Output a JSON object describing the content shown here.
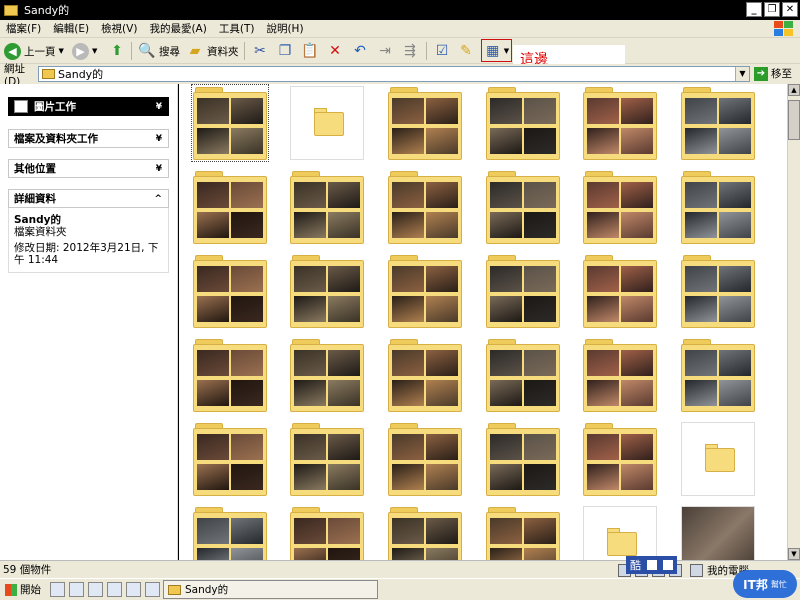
{
  "window": {
    "title": "Sandy的",
    "buttons": {
      "minimize": "_",
      "restore": "❐",
      "close": "✕"
    }
  },
  "menu": [
    "檔案(F)",
    "編輯(E)",
    "檢視(V)",
    "我的最愛(A)",
    "工具(T)",
    "說明(H)"
  ],
  "toolbar": {
    "back_label": "上一頁",
    "search_label": "搜尋",
    "folders_label": "資料夾"
  },
  "annotation": {
    "text": "這邊",
    "color": "#e00000"
  },
  "address": {
    "label": "網址(D)",
    "value": "Sandy的",
    "go_label": "移至"
  },
  "left_pane": {
    "picture_tasks": "圖片工作",
    "file_folder_tasks": "檔案及資料夾工作",
    "other_places": "其他位置",
    "details": {
      "header": "詳細資料",
      "name": "Sandy的",
      "type": "檔案資料夾",
      "modified": "修改日期: 2012年3月21日, 下午 11:44"
    }
  },
  "status": {
    "count": "59 個物件",
    "my_computer": "我的電腦"
  },
  "taskbar": {
    "start": "開始",
    "task": "Sandy的"
  },
  "ime": {
    "label": "酷"
  },
  "watermark": {
    "text": "IT邦",
    "sub": "幫忙"
  },
  "colors": {
    "folder": "#f6dc7c",
    "selection_border": "#d01010"
  }
}
